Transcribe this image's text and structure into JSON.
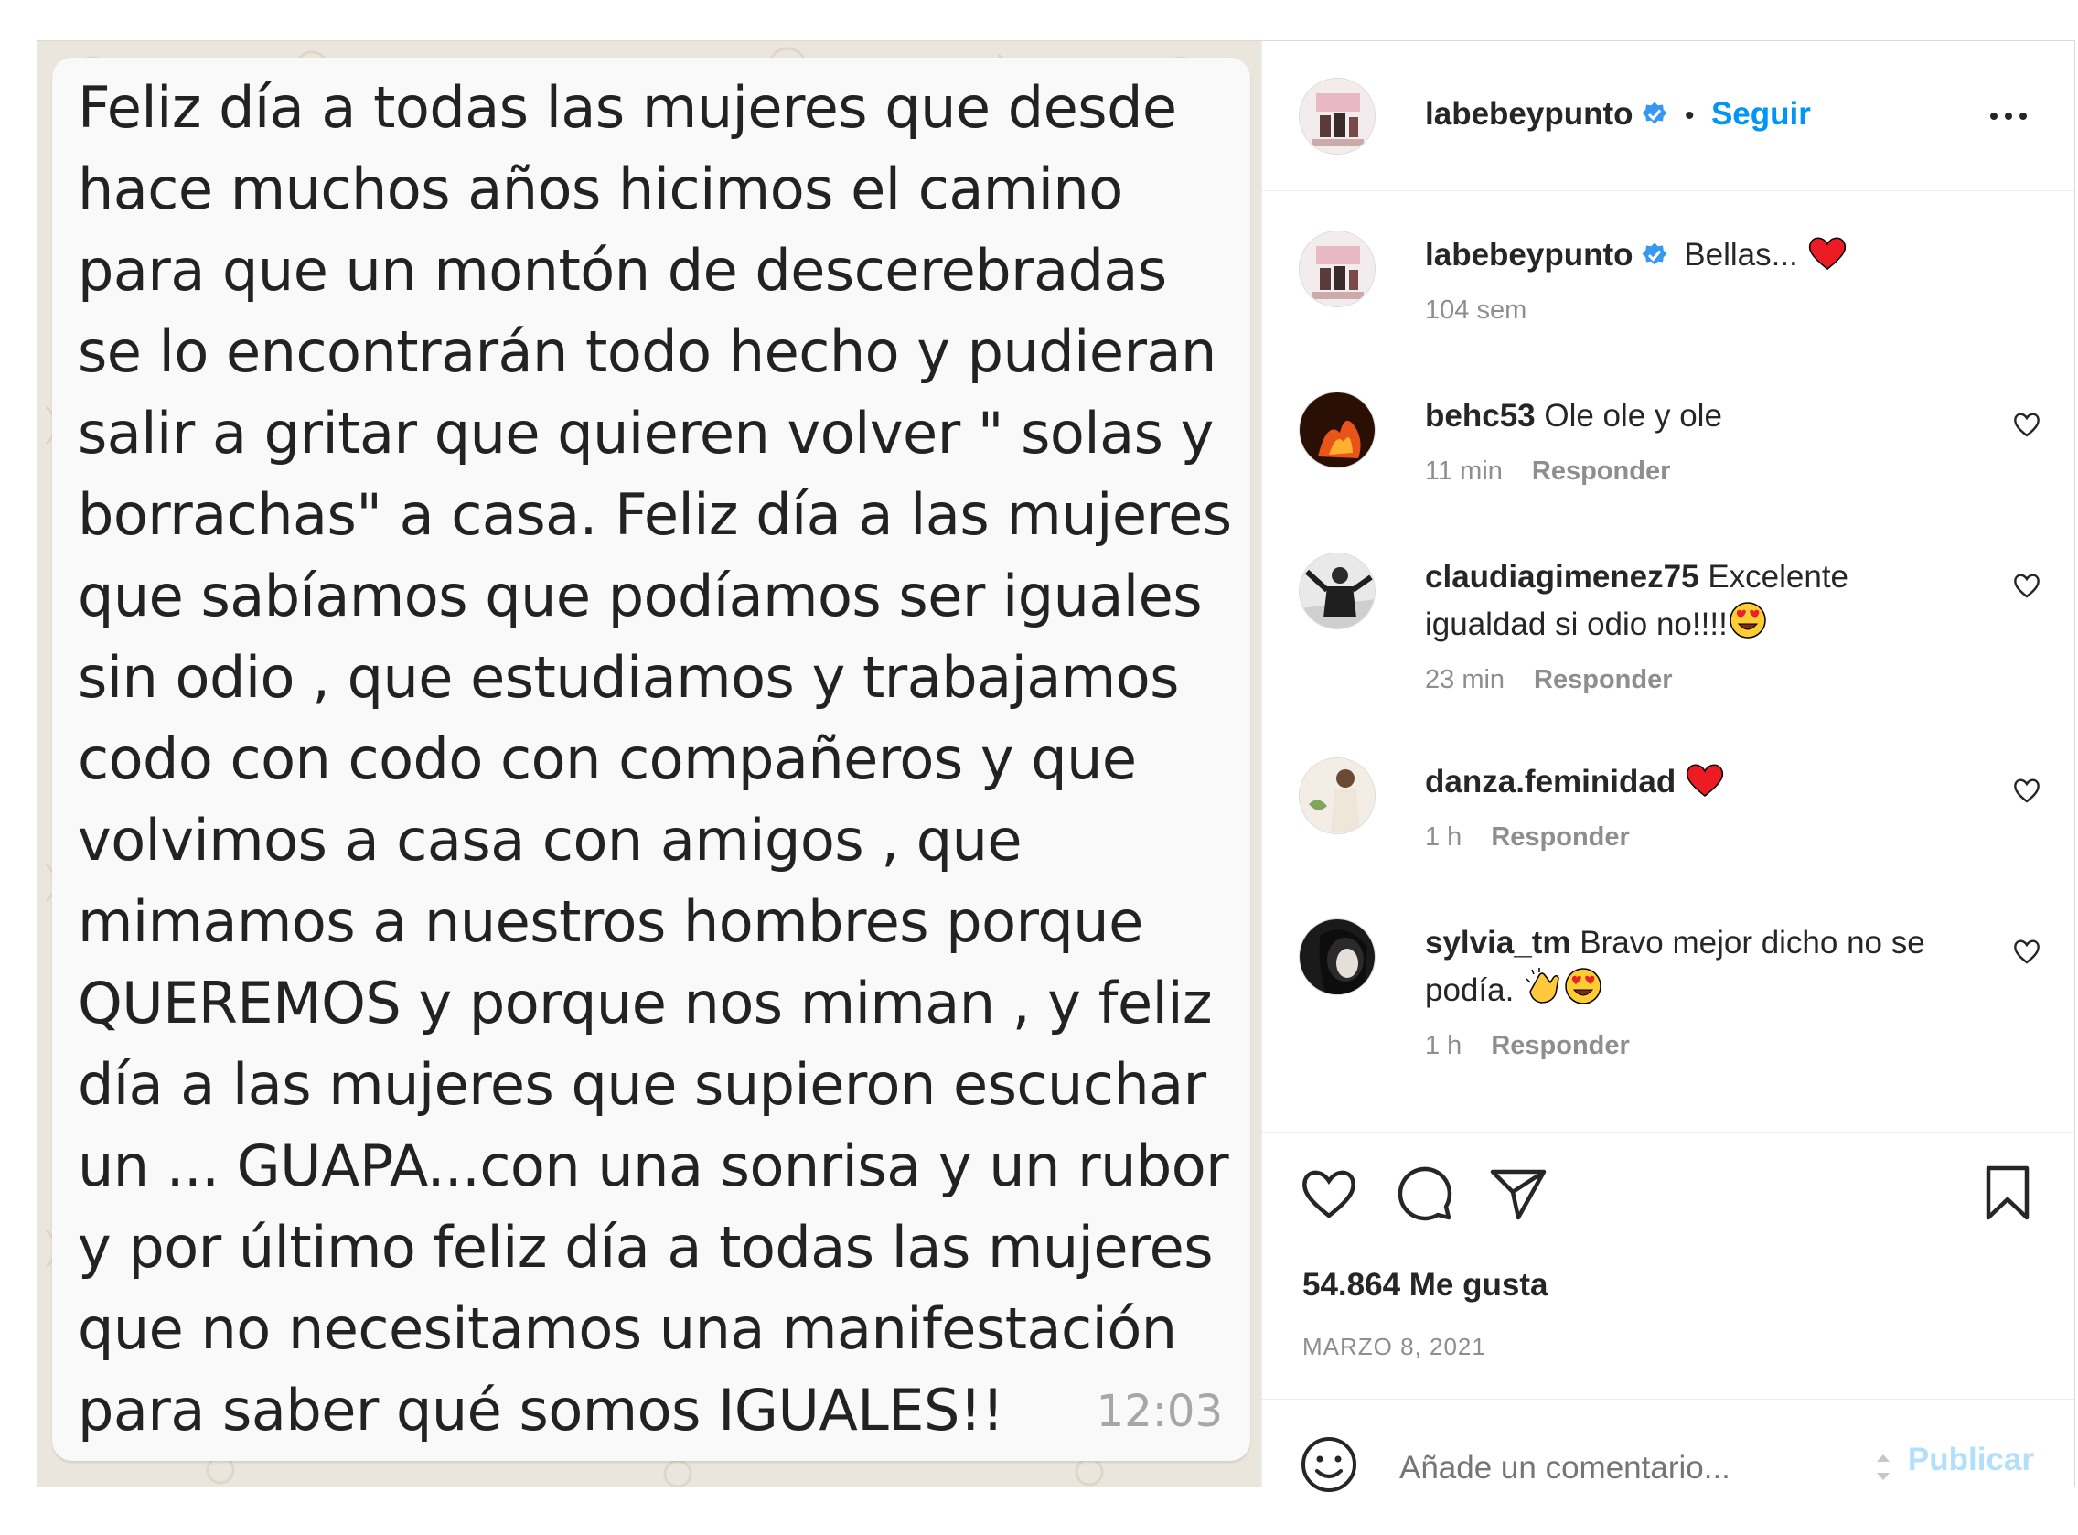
{
  "post_image": {
    "message_text": "Feliz día a todas las mujeres que desde\nhace muchos años hicimos el camino\npara que un montón de descerebradas\nse lo encontrarán todo hecho y pudieran\nsalir a gritar que quieren volver \" solas y\nborrachas\" a casa. Feliz día a las mujeres\nque sabíamos que podíamos ser iguales\nsin odio , que estudiamos y trabajamos\ncodo con codo con compañeros y que\nvolvimos a casa con amigos , que\nmimamos a nuestros hombres porque\nQUEREMOS y porque nos miman , y feliz\ndía a las mujeres que supieron escuchar\nun ... GUAPA...con una sonrisa y un rubor\ny por último feliz día a todas las mujeres\nque no necesitamos una manifestación\npara saber qué somos IGUALES!!",
    "time": "12:03"
  },
  "header": {
    "username": "labebeypunto",
    "dot": "•",
    "follow_label": "Seguir",
    "more_icon": "more-options-icon"
  },
  "caption": {
    "username": "labebeypunto",
    "text": "Bellas...",
    "time": "104 sem"
  },
  "comments": [
    {
      "username": "behc53",
      "text": "Ole ole y ole",
      "time": "11 min",
      "reply": "Responder"
    },
    {
      "username": "claudiagimenez75",
      "text": "Excelente igualdad si odio no!!!!",
      "time": "23 min",
      "reply": "Responder"
    },
    {
      "username": "danza.feminidad",
      "text": "",
      "time": "1 h",
      "reply": "Responder"
    },
    {
      "username": "sylvia_tm",
      "text": "Bravo mejor dicho no se podía.",
      "time": "1 h",
      "reply": "Responder"
    }
  ],
  "likes": "54.864 Me gusta",
  "date": "MARZO 8, 2021",
  "compose": {
    "placeholder": "Añade un comentario...",
    "publish_label": "Publicar"
  },
  "colors": {
    "accent": "#0095f6",
    "publish_disabled": "#b2dffc",
    "heart_red": "#ed1c24",
    "chat_bg": "#ebe6dc"
  }
}
